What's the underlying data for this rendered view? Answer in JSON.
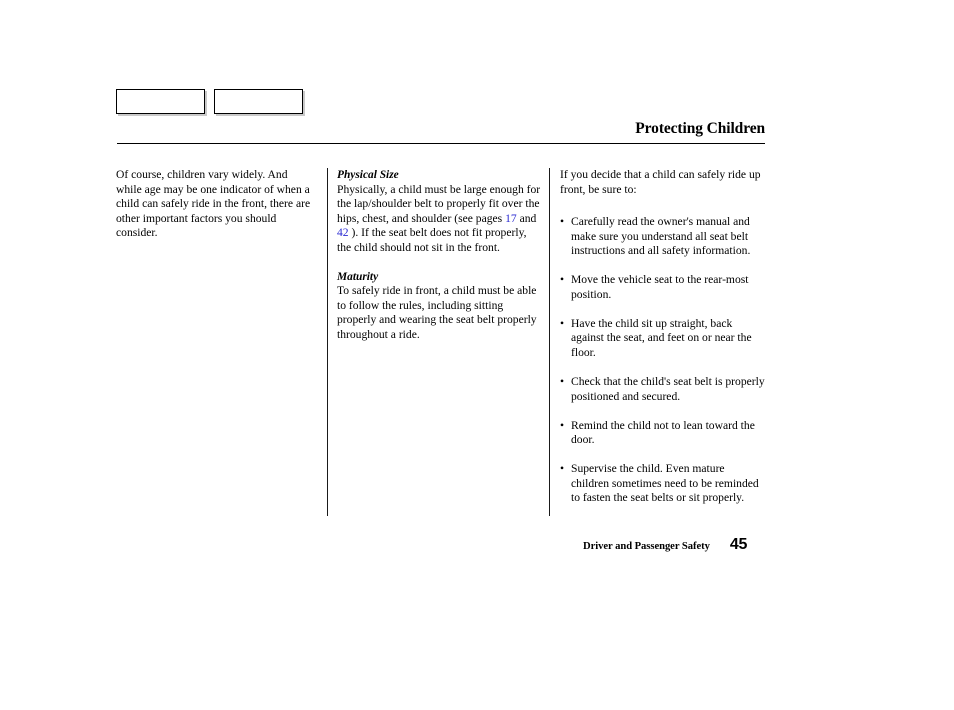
{
  "header": {
    "title": "Protecting Children",
    "nav_buttons": [
      {
        "label": "",
        "name": "nav-button-left"
      },
      {
        "label": "",
        "name": "nav-button-right"
      }
    ]
  },
  "link_color": "#2a2ad2",
  "columns": {
    "col1": {
      "paragraph": "Of course, children vary widely. And while age may be one indicator of when a child can safely ride in the front, there are other important factors you should consider."
    },
    "col2": {
      "section1": {
        "heading": "Physical Size",
        "text_part1": "Physically, a child must be large enough for the lap/shoulder belt to properly fit over the hips, chest, and shoulder (see pages ",
        "link1": "17",
        "text_mid": " and ",
        "link2": "42",
        "text_part2": " ). If the seat belt does not fit properly, the child should not sit in the front."
      },
      "section2": {
        "heading": "Maturity",
        "text": "To safely ride in front, a child must be able to follow the rules, including sitting properly and wearing the seat belt properly throughout a ride."
      }
    },
    "col3": {
      "intro": "If you decide that a child can safely ride up front, be sure to:",
      "bullet_char": "•",
      "bullets": [
        "Carefully read the owner's manual and make sure you understand all seat belt instructions and all safety information.",
        "Move the vehicle seat to the rear-most position.",
        "Have the child sit up straight, back against the seat, and feet on or near the floor.",
        "Check that the child's seat belt is properly positioned and secured.",
        "Remind the child not to lean toward the door.",
        "Supervise the child. Even mature children sometimes need to be reminded to fasten the seat belts or sit properly."
      ]
    }
  },
  "footer": {
    "label": "Driver and Passenger Safety",
    "page_number": "45"
  }
}
